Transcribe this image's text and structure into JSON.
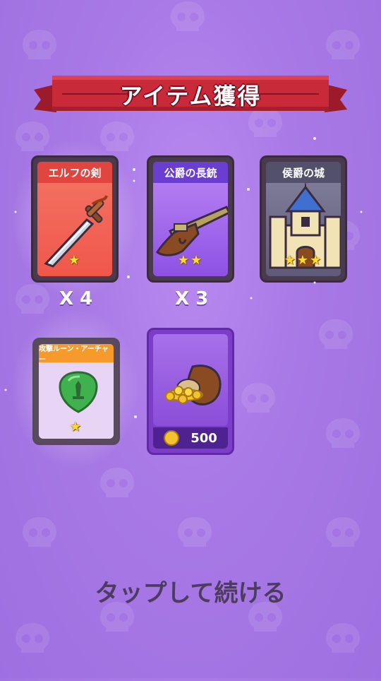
{
  "banner": {
    "title": "アイテム獲得"
  },
  "cards": [
    {
      "name": "エルフの剣",
      "stars": "★",
      "quantity": "X 4",
      "icon": "sword-icon"
    },
    {
      "name": "公爵の長銃",
      "stars": "★★",
      "quantity": "X 3",
      "icon": "musket-icon"
    },
    {
      "name": "侯爵の城",
      "stars": "★★★",
      "icon": "castle-icon"
    },
    {
      "name": "攻撃ルーン・アーチャー",
      "stars": "★",
      "icon": "rune-shield-icon"
    },
    {
      "amount": "500",
      "icon": "gold-sack-icon"
    }
  ],
  "footer": {
    "tap_to_continue": "タップして続ける"
  },
  "colors": {
    "background": "#a97ae6",
    "banner_red": "#c92a3a",
    "sword_card": "#f0574a",
    "musket_card": "#8e52e4",
    "castle_card": "#5e5b78",
    "rune_header": "#f79a2c",
    "gold_card": "#7c3ec8",
    "star": "#ffd83a"
  }
}
